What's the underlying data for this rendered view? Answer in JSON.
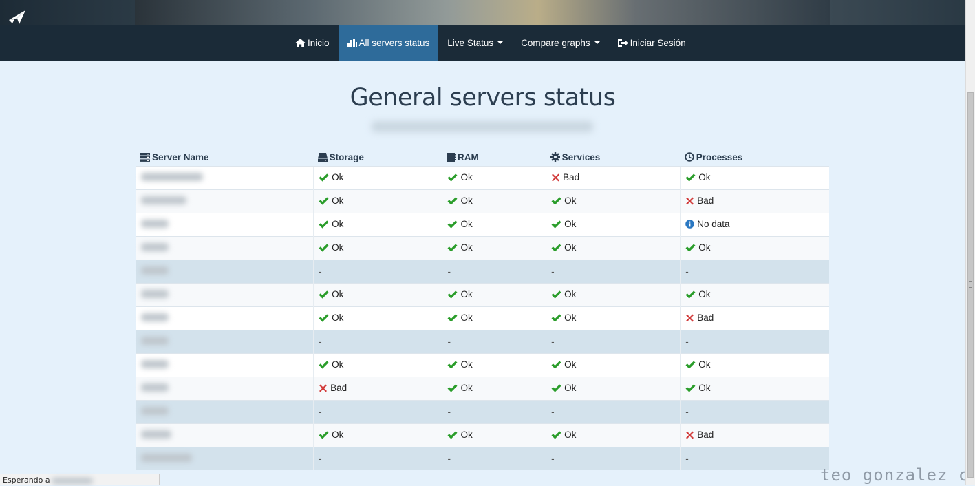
{
  "nav": {
    "items": [
      {
        "label": "Inicio",
        "icon": "home-icon"
      },
      {
        "label": "All servers status",
        "icon": "bar-chart-icon",
        "active": true
      },
      {
        "label": "Live Status",
        "dropdown": true
      },
      {
        "label": "Compare graphs",
        "dropdown": true
      },
      {
        "label": "Iniciar Sesión",
        "icon": "log-in-icon"
      }
    ]
  },
  "page": {
    "title": "General servers status"
  },
  "table": {
    "headers": [
      {
        "label": "Server Name",
        "icon": "server-icon"
      },
      {
        "label": "Storage",
        "icon": "hdd-icon"
      },
      {
        "label": "RAM",
        "icon": "memory-icon"
      },
      {
        "label": "Services",
        "icon": "cog-icon"
      },
      {
        "label": "Processes",
        "icon": "clock-icon"
      }
    ],
    "rows": [
      {
        "name_blur": 90,
        "cells": [
          "Ok",
          "Ok",
          "Bad",
          "Ok"
        ]
      },
      {
        "name_blur": 66,
        "cells": [
          "Ok",
          "Ok",
          "Ok",
          "Bad"
        ]
      },
      {
        "name_blur": 40,
        "cells": [
          "Ok",
          "Ok",
          "Ok",
          "No data"
        ]
      },
      {
        "name_blur": 40,
        "cells": [
          "Ok",
          "Ok",
          "Ok",
          "Ok"
        ]
      },
      {
        "name_blur": 40,
        "cells": [
          "-",
          "-",
          "-",
          "-"
        ]
      },
      {
        "name_blur": 40,
        "cells": [
          "Ok",
          "Ok",
          "Ok",
          "Ok"
        ]
      },
      {
        "name_blur": 40,
        "cells": [
          "Ok",
          "Ok",
          "Ok",
          "Bad"
        ]
      },
      {
        "name_blur": 40,
        "cells": [
          "-",
          "-",
          "-",
          "-"
        ]
      },
      {
        "name_blur": 40,
        "cells": [
          "Ok",
          "Ok",
          "Ok",
          "Ok"
        ]
      },
      {
        "name_blur": 40,
        "cells": [
          "Bad",
          "Ok",
          "Ok",
          "Ok"
        ]
      },
      {
        "name_blur": 40,
        "cells": [
          "-",
          "-",
          "-",
          "-"
        ]
      },
      {
        "name_blur": 44,
        "cells": [
          "Ok",
          "Ok",
          "Ok",
          "Bad"
        ]
      },
      {
        "name_blur": 74,
        "cells": [
          "-",
          "-",
          "-",
          "-"
        ]
      }
    ]
  },
  "statusbar": {
    "text": "Esperando a"
  },
  "watermark": "teo gonzalez c",
  "colors": {
    "ok": "#2a9d2a",
    "bad": "#d23b3b",
    "info": "#2b78c2",
    "navbar": "#1b2b38",
    "nav_active": "#2e6b9a",
    "background": "#e5f1fb"
  }
}
